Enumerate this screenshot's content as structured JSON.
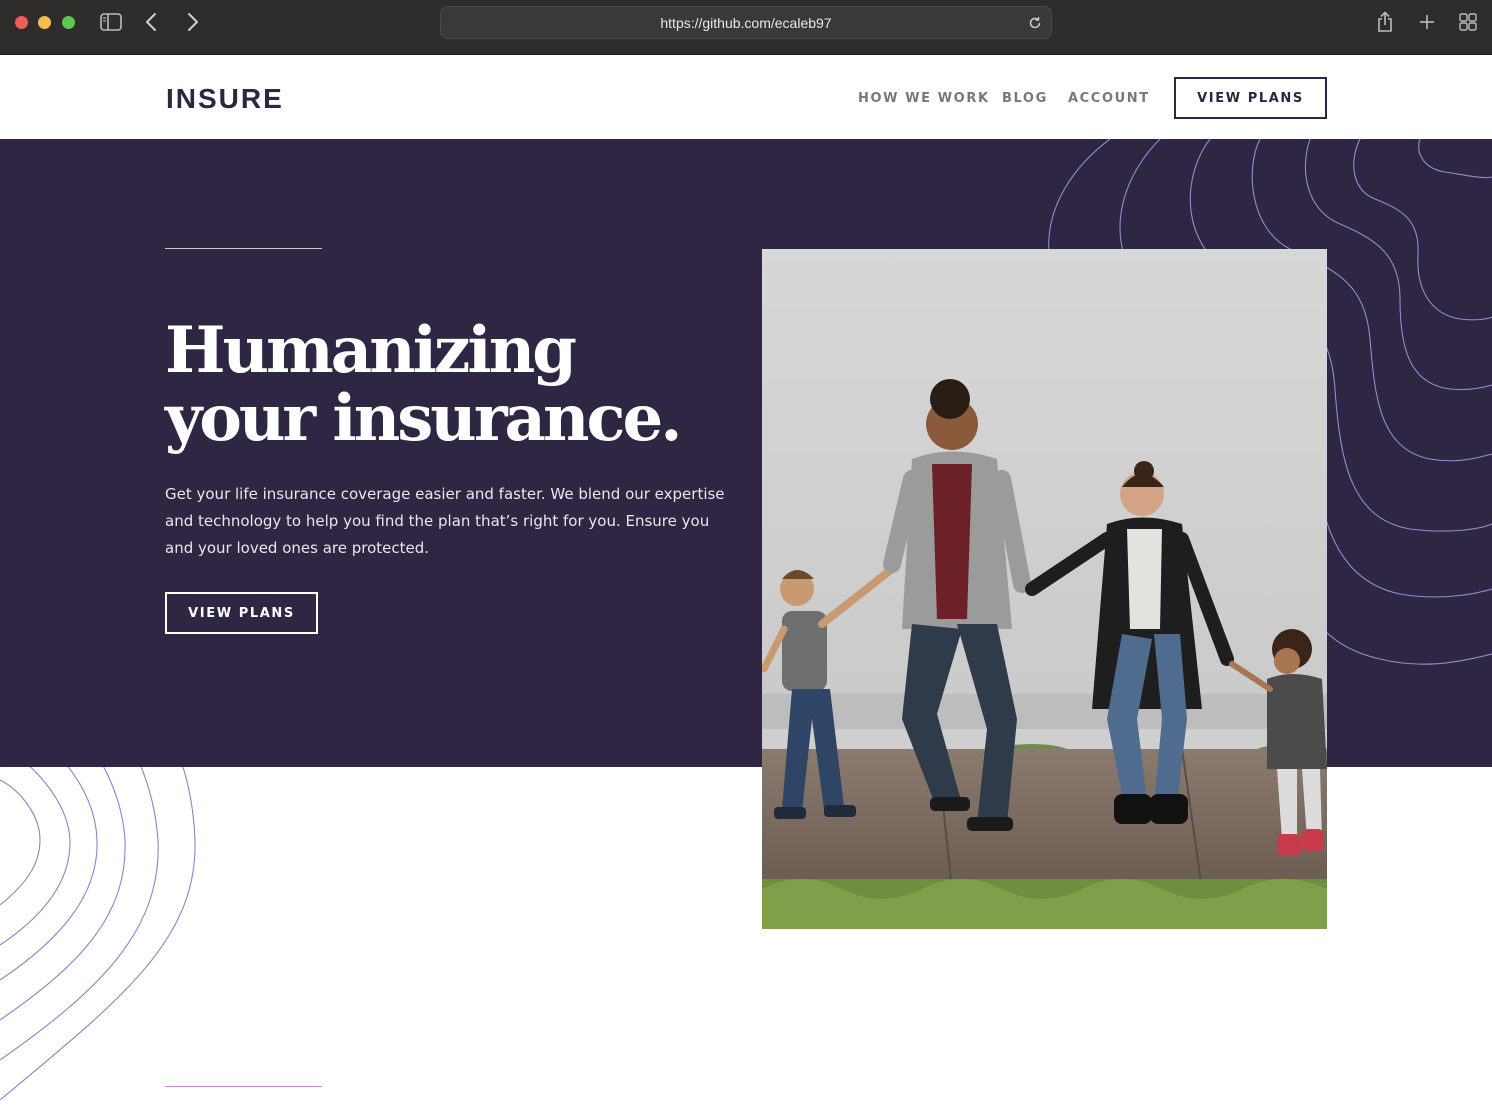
{
  "browser": {
    "url": "https://github.com/ecaleb97"
  },
  "header": {
    "logo": "INSURE",
    "nav": [
      "HOW WE WORK",
      "BLOG",
      "ACCOUNT"
    ],
    "cta_label": "VIEW PLANS"
  },
  "hero": {
    "title_line1": "Humanizing",
    "title_line2": "your insurance.",
    "text": "Get your life insurance coverage easier and faster. We blend our expertise and technology to help you find the plan that’s right for you. Ensure you and your loved ones are protected.",
    "cta_label": "VIEW PLANS"
  },
  "colors": {
    "hero_bg": "#2e2642",
    "accent_line": "#c58ed8"
  },
  "icons": [
    "sidebar-toggle-icon",
    "chevron-left-icon",
    "chevron-right-icon",
    "reload-icon",
    "share-icon",
    "plus-icon",
    "tab-grid-icon"
  ]
}
